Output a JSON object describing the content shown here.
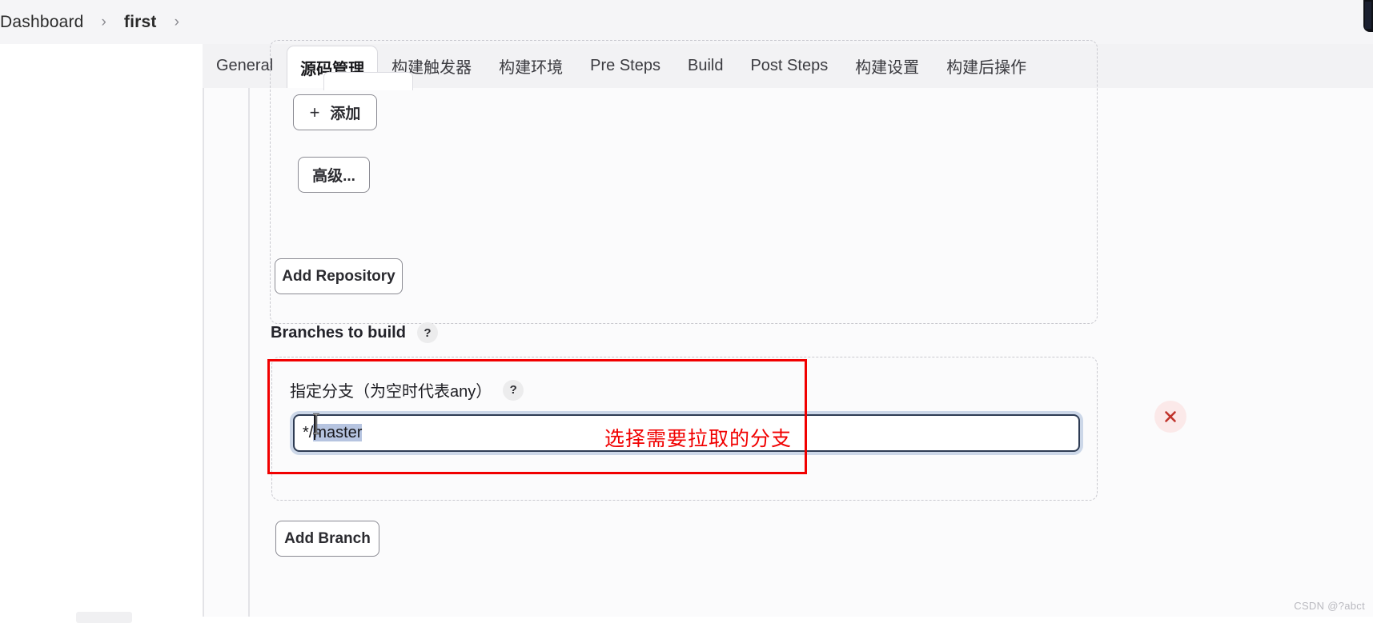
{
  "breadcrumb": {
    "items": [
      {
        "label": "Dashboard",
        "bold": false
      },
      {
        "label": "first",
        "bold": true
      }
    ],
    "separator": "›"
  },
  "tabs": [
    {
      "label": "General",
      "active": false
    },
    {
      "label": "源码管理",
      "active": true
    },
    {
      "label": "构建触发器",
      "active": false
    },
    {
      "label": "构建环境",
      "active": false
    },
    {
      "label": "Pre Steps",
      "active": false
    },
    {
      "label": "Build",
      "active": false
    },
    {
      "label": "Post Steps",
      "active": false
    },
    {
      "label": "构建设置",
      "active": false
    },
    {
      "label": "构建后操作",
      "active": false
    }
  ],
  "repository_section": {
    "add_button": {
      "plus": "+",
      "label": "添加"
    },
    "advanced_button": {
      "label": "高级..."
    },
    "add_repository_button": {
      "label": "Add Repository"
    }
  },
  "branches_section": {
    "heading": "Branches to build",
    "heading_help": "?",
    "branch_label": "指定分支（为空时代表any）",
    "branch_label_help": "?",
    "branch_input": {
      "value_prefix": "*/",
      "value_selected": "master",
      "full_value": "*/master",
      "placeholder": ""
    },
    "remove_icon": "close-x-icon",
    "add_branch_button": {
      "label": "Add Branch"
    }
  },
  "annotation": {
    "note_text": "选择需要拉取的分支",
    "color": "#f10000"
  },
  "watermark": {
    "text": "CSDN @?abct"
  },
  "colors": {
    "page_bg": "#fbfbfc",
    "breadcrumb_bg": "#f5f5f7",
    "tabstrip_bg": "#f2f2f4",
    "accent_red": "#f10000",
    "input_border": "#2e3c54",
    "input_glow": "#ccd7e8",
    "selection": "#b6c4e0",
    "dashed_border": "#c9c9cf"
  }
}
